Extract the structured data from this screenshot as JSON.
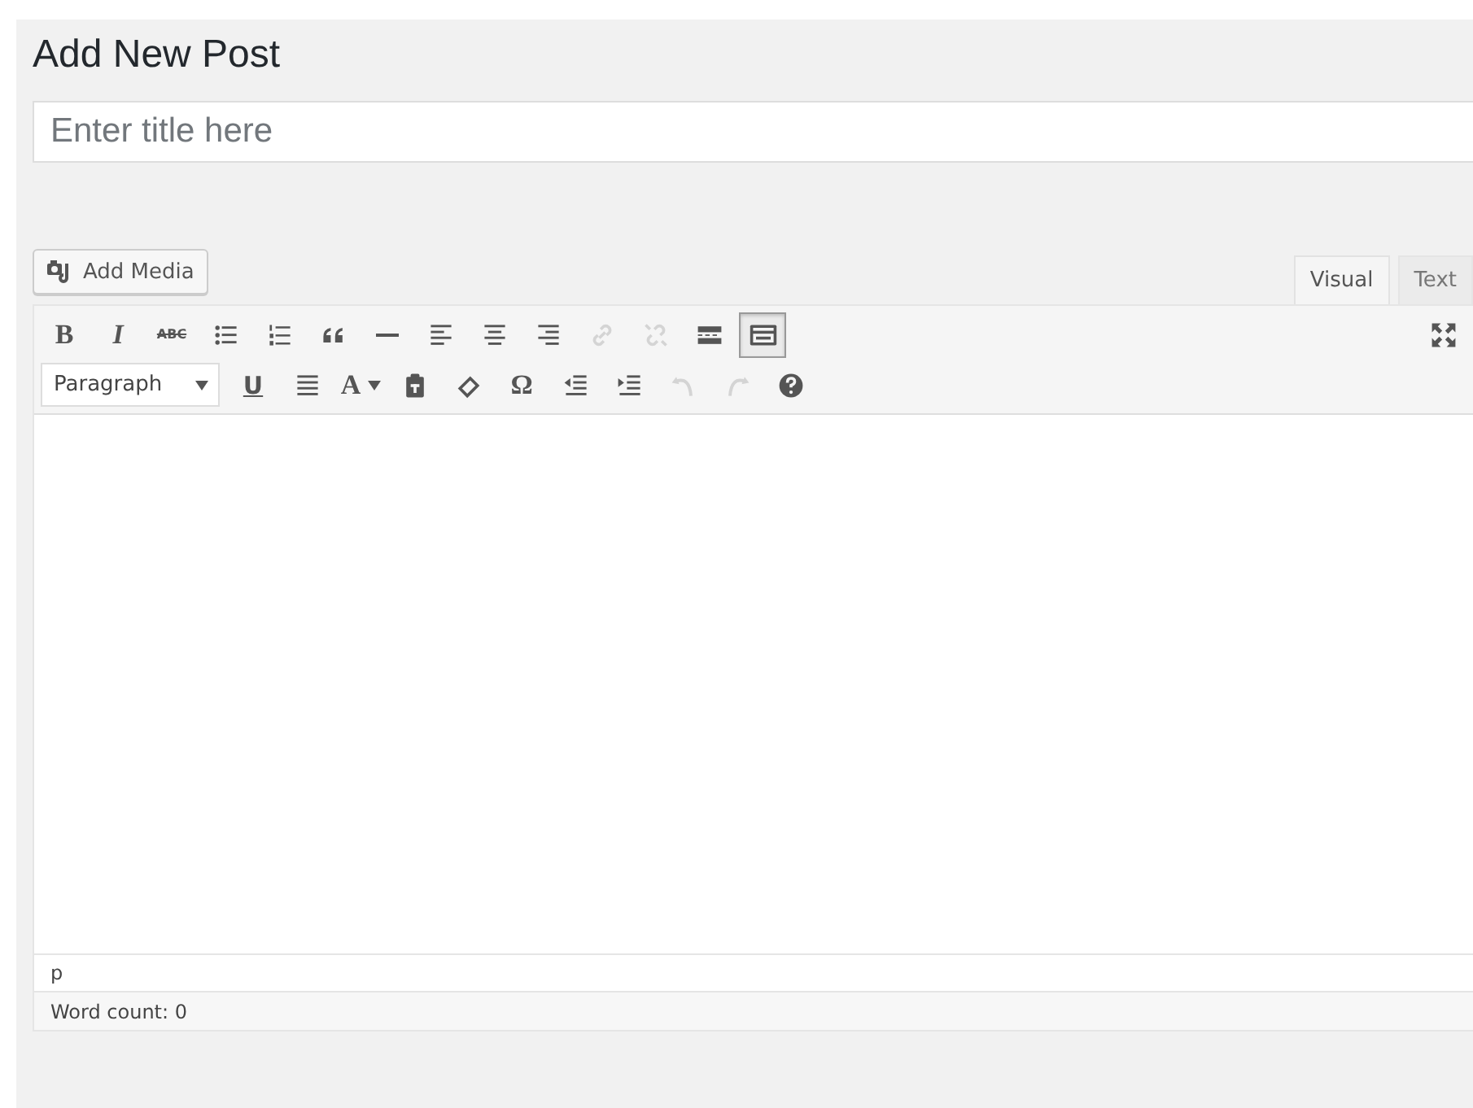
{
  "heading": "Add New Post",
  "title_field": {
    "placeholder": "Enter title here"
  },
  "add_media": {
    "label": "Add Media"
  },
  "tabs": [
    {
      "label": "Visual",
      "selected": true
    },
    {
      "label": "Text",
      "selected": false
    }
  ],
  "toolbar_rows": [
    [
      {
        "kind": "glyph",
        "label": "B",
        "disabled": false,
        "selected": false
      },
      {
        "kind": "glyph",
        "label": "I",
        "disabled": false,
        "selected": false
      },
      {
        "kind": "glyph",
        "label": "ABC",
        "disabled": false,
        "selected": false
      },
      {
        "kind": "icon",
        "disabled": false,
        "selected": false
      },
      {
        "kind": "icon",
        "disabled": false,
        "selected": false
      },
      {
        "kind": "icon",
        "disabled": false,
        "selected": false
      },
      {
        "kind": "icon",
        "disabled": false,
        "selected": false
      },
      {
        "kind": "icon",
        "disabled": false,
        "selected": false
      },
      {
        "kind": "icon",
        "disabled": false,
        "selected": false
      },
      {
        "kind": "icon",
        "disabled": false,
        "selected": false
      },
      {
        "kind": "icon",
        "disabled": true,
        "selected": false
      },
      {
        "kind": "icon",
        "disabled": true,
        "selected": false
      },
      {
        "kind": "icon",
        "disabled": false,
        "selected": false
      },
      {
        "kind": "icon",
        "disabled": false,
        "selected": true
      }
    ],
    [
      {
        "kind": "select",
        "label": "Paragraph"
      },
      {
        "kind": "glyph",
        "label": "U",
        "disabled": false,
        "selected": false
      },
      {
        "kind": "icon",
        "disabled": false,
        "selected": false
      },
      {
        "kind": "glyph",
        "label": "A",
        "disabled": false,
        "selected": false
      },
      {
        "kind": "icon",
        "disabled": false,
        "selected": false
      },
      {
        "kind": "icon",
        "disabled": false,
        "selected": false
      },
      {
        "kind": "glyph",
        "label": "Ω",
        "disabled": false,
        "selected": false
      },
      {
        "kind": "icon",
        "disabled": false,
        "selected": false
      },
      {
        "kind": "icon",
        "disabled": false,
        "selected": false
      },
      {
        "kind": "icon",
        "disabled": true,
        "selected": false
      },
      {
        "kind": "icon",
        "disabled": true,
        "selected": false
      },
      {
        "kind": "icon",
        "disabled": false,
        "selected": false
      }
    ]
  ],
  "path": "p",
  "word_count": "Word count: 0"
}
